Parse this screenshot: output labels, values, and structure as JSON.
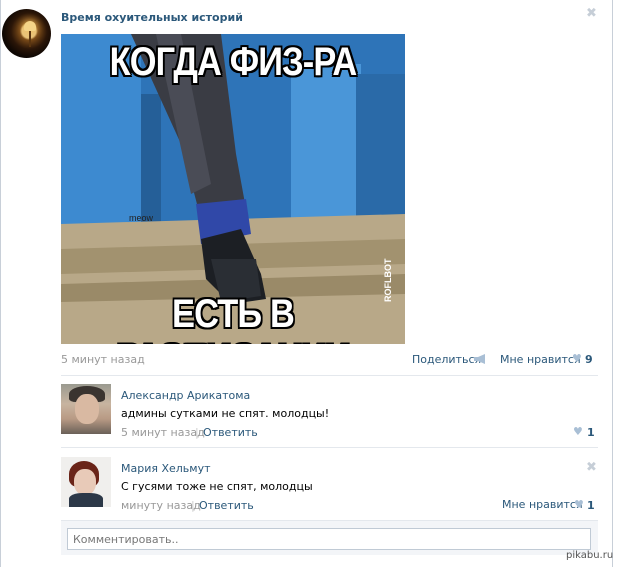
{
  "post": {
    "author": "Время охуительных историй",
    "close_icon": "close-icon",
    "meme": {
      "top_text": "КОГДА ФИЗ-РА",
      "bottom_text": "ЕСТЬ В РАСПИСАНИИ",
      "watermark": "meow",
      "side_text": "ROFLBOT"
    },
    "time": "5 минут назад",
    "share_label": "Поделиться",
    "like_label": "Мне нравится",
    "like_count": "9"
  },
  "comments": [
    {
      "author": "Александр Арикатома",
      "text": "админы сутками не спят. молодцы!",
      "time": "5 минут назад",
      "separator": "|",
      "reply_label": "Ответить",
      "like_count": "1"
    },
    {
      "author": "Мария Хельмут",
      "text": "С гусями тоже не спят, молодцы",
      "time": "минуту назад",
      "separator": "|",
      "reply_label": "Ответить",
      "like_label": "Мне нравится",
      "like_count": "1"
    }
  ],
  "comment_box": {
    "placeholder": "Комментировать.."
  },
  "watermark": "pikabu.ru",
  "colors": {
    "link": "#2b587a",
    "muted": "#999999",
    "heart": "#a9bfd5"
  }
}
